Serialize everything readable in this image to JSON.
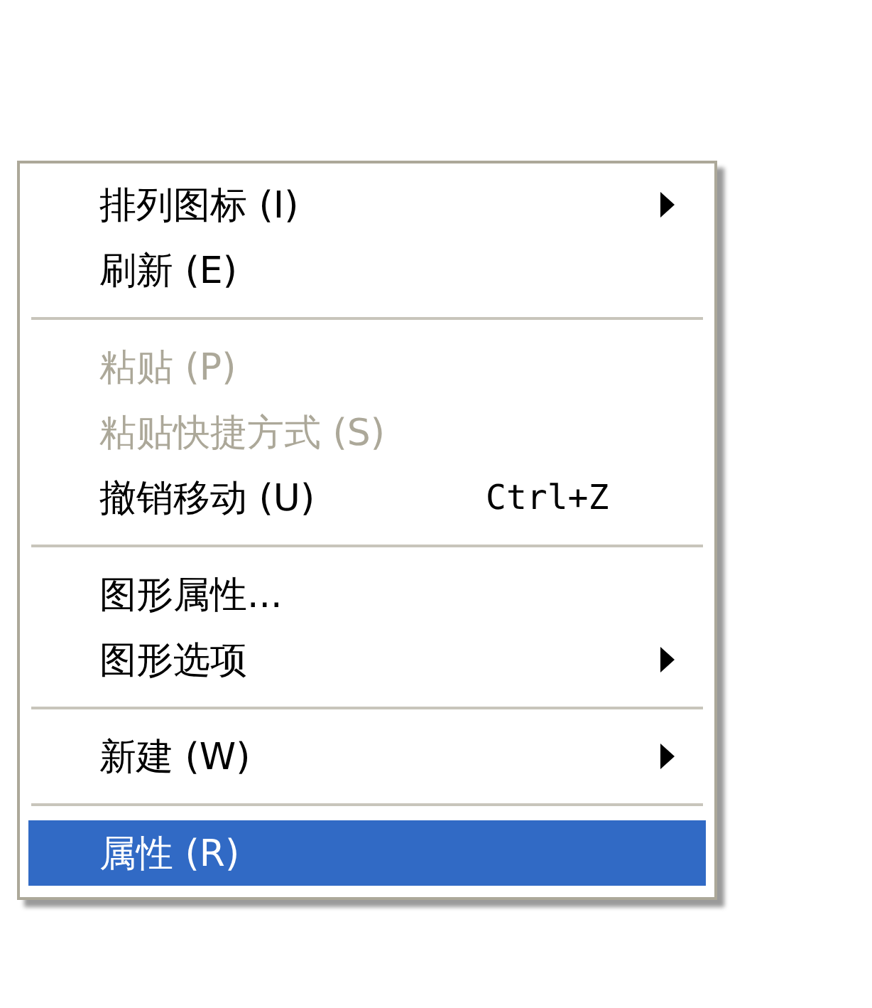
{
  "context_menu": {
    "items": [
      {
        "kind": "item",
        "label": "排列图标 (I)",
        "disabled": false,
        "submenu": true,
        "selected": false
      },
      {
        "kind": "item",
        "label": "刷新 (E)",
        "disabled": false,
        "submenu": false,
        "selected": false
      },
      {
        "kind": "separator"
      },
      {
        "kind": "item",
        "label": "粘贴 (P)",
        "disabled": true,
        "submenu": false,
        "selected": false
      },
      {
        "kind": "item",
        "label": "粘贴快捷方式 (S)",
        "disabled": true,
        "submenu": false,
        "selected": false
      },
      {
        "kind": "item",
        "label": "撤销移动 (U)",
        "shortcut": "Ctrl+Z",
        "disabled": false,
        "submenu": false,
        "selected": false
      },
      {
        "kind": "separator"
      },
      {
        "kind": "item",
        "label": "图形属性...",
        "disabled": false,
        "submenu": false,
        "selected": false
      },
      {
        "kind": "item",
        "label": "图形选项",
        "disabled": false,
        "submenu": true,
        "selected": false
      },
      {
        "kind": "separator"
      },
      {
        "kind": "item",
        "label": "新建 (W)",
        "disabled": false,
        "submenu": true,
        "selected": false
      },
      {
        "kind": "separator"
      },
      {
        "kind": "item",
        "label": "属性 (R)",
        "disabled": false,
        "submenu": false,
        "selected": true
      }
    ]
  }
}
